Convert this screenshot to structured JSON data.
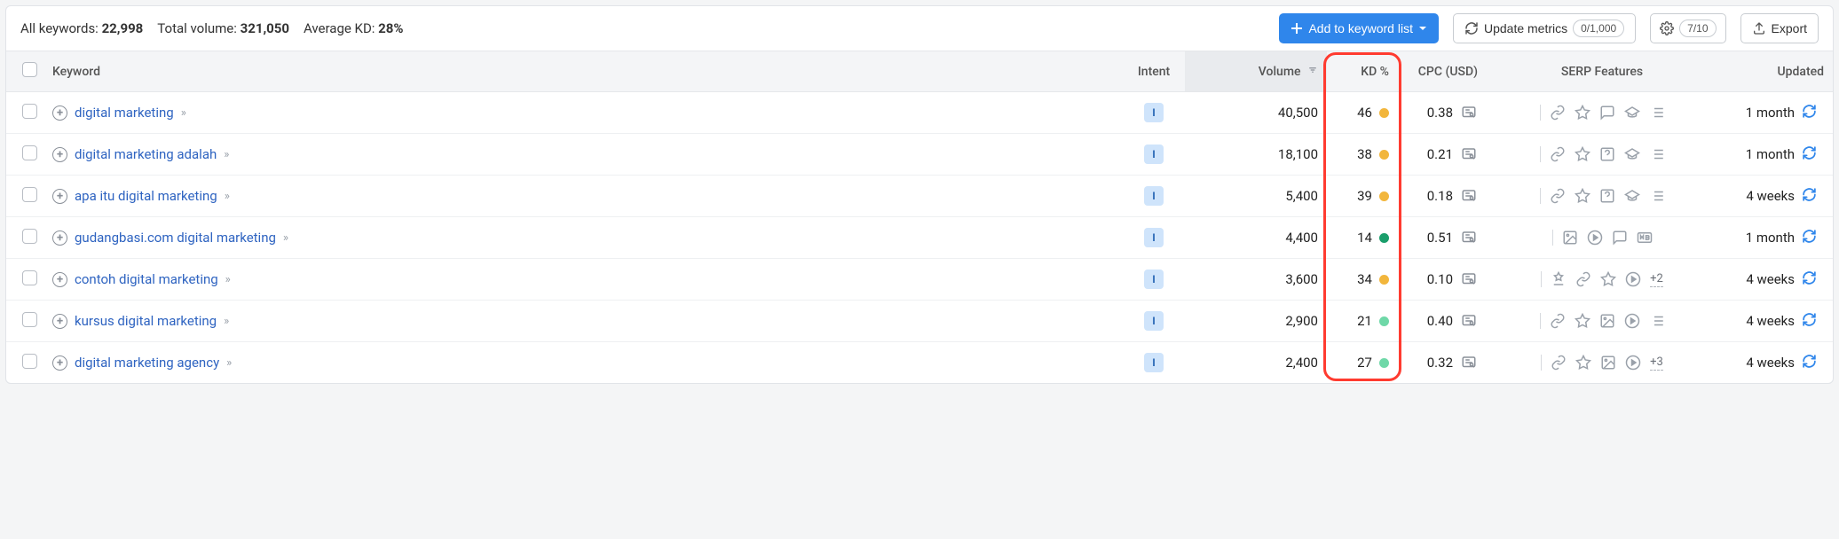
{
  "summary": {
    "all_keywords_label": "All keywords:",
    "all_keywords_value": "22,998",
    "total_volume_label": "Total volume:",
    "total_volume_value": "321,050",
    "avg_kd_label": "Average KD:",
    "avg_kd_value": "28%"
  },
  "actions": {
    "add_to_list": "Add to keyword list",
    "update_metrics": "Update metrics",
    "update_count": "0/1,000",
    "settings_badge": "7/10",
    "export": "Export"
  },
  "columns": {
    "keyword": "Keyword",
    "intent": "Intent",
    "volume": "Volume",
    "kd": "KD %",
    "cpc": "CPC (USD)",
    "serp": "SERP Features",
    "updated": "Updated"
  },
  "rows": [
    {
      "keyword": "digital marketing",
      "intent": "I",
      "volume": "40,500",
      "kd": "46",
      "kd_color": "#f2b63c",
      "cpc": "0.38",
      "features": [
        "link",
        "star",
        "review",
        "knowledge",
        "list"
      ],
      "more": "",
      "updated": "1 month"
    },
    {
      "keyword": "digital marketing adalah",
      "intent": "I",
      "volume": "18,100",
      "kd": "38",
      "kd_color": "#f2b63c",
      "cpc": "0.21",
      "features": [
        "link",
        "star",
        "faq",
        "knowledge",
        "list"
      ],
      "more": "",
      "updated": "1 month"
    },
    {
      "keyword": "apa itu digital marketing",
      "intent": "I",
      "volume": "5,400",
      "kd": "39",
      "kd_color": "#f2b63c",
      "cpc": "0.18",
      "features": [
        "link",
        "star",
        "faq",
        "knowledge",
        "list"
      ],
      "more": "",
      "updated": "4 weeks"
    },
    {
      "keyword": "gudangbasi.com digital marketing",
      "intent": "I",
      "volume": "4,400",
      "kd": "14",
      "kd_color": "#1a9e6b",
      "cpc": "0.51",
      "features": [
        "image",
        "video",
        "review",
        "ads"
      ],
      "more": "",
      "updated": "1 month"
    },
    {
      "keyword": "contoh digital marketing",
      "intent": "I",
      "volume": "3,600",
      "kd": "34",
      "kd_color": "#f2b63c",
      "cpc": "0.10",
      "features": [
        "snippet",
        "link",
        "star",
        "video"
      ],
      "more": "+2",
      "updated": "4 weeks"
    },
    {
      "keyword": "kursus digital marketing",
      "intent": "I",
      "volume": "2,900",
      "kd": "21",
      "kd_color": "#6fd8a8",
      "cpc": "0.40",
      "features": [
        "link",
        "star",
        "image",
        "video",
        "list"
      ],
      "more": "",
      "updated": "4 weeks"
    },
    {
      "keyword": "digital marketing agency",
      "intent": "I",
      "volume": "2,400",
      "kd": "27",
      "kd_color": "#6fd8a8",
      "cpc": "0.32",
      "features": [
        "link",
        "star",
        "image",
        "video"
      ],
      "more": "+3",
      "updated": "4 weeks"
    }
  ]
}
